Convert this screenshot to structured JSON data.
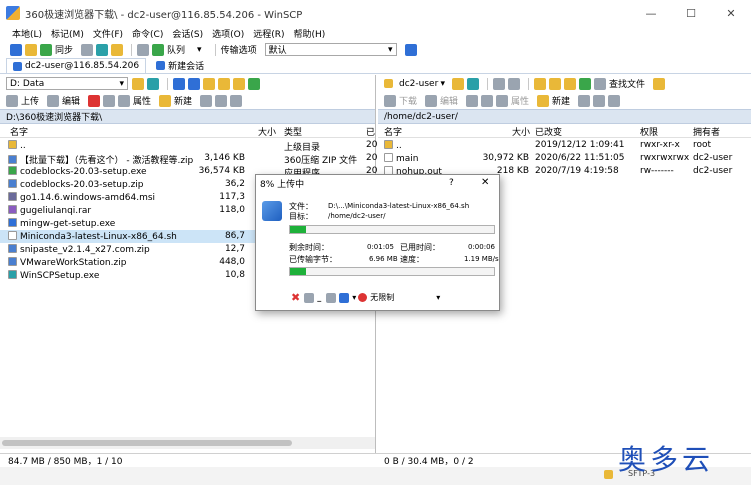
{
  "window": {
    "title": "360极速浏览器下载\\ - dc2-user@116.85.54.206 - WinSCP",
    "controls": [
      "—",
      "☐",
      "✕"
    ]
  },
  "menu": [
    "本地(L)",
    "标记(M)",
    "文件(F)",
    "命令(C)",
    "会话(S)",
    "选项(O)",
    "远程(R)",
    "帮助(H)"
  ],
  "toolbar": {
    "sync_label": "同步",
    "queue_label": "队列",
    "transfer_label": "传输选项",
    "transfer_value": "默认"
  },
  "tabs": {
    "session": "dc2-user@116.85.54.206",
    "new_session": "新建会话"
  },
  "left": {
    "drive": "D: Data",
    "upload_label": "上传",
    "edit_label": "编辑",
    "props_label": "属性",
    "new_label": "新建",
    "path": "D:\\360极速浏览器下载\\",
    "headers": {
      "name": "名字",
      "size": "大小",
      "type": "类型",
      "changed": "已"
    },
    "rows": [
      {
        "name": "..",
        "size": "",
        "type": "上级目录",
        "changed": "20",
        "icon_color": "#e9b838",
        "selected": false
      },
      {
        "name": "【批量下载】（先看这个） - 激活教程等.zip",
        "size": "3,146 KB",
        "type": "360压缩 ZIP 文件",
        "changed": "20",
        "icon_color": "#4a7fd0",
        "selected": false
      },
      {
        "name": "codeblocks-20.03-setup.exe",
        "size": "36,574 KB",
        "type": "应用程序",
        "changed": "20",
        "icon_color": "#3aa64a",
        "selected": false
      },
      {
        "name": "codeblocks-20.03-setup.zip",
        "size": "36,2",
        "type": "",
        "changed": "",
        "icon_color": "#4a7fd0",
        "selected": false
      },
      {
        "name": "go1.14.6.windows-amd64.msi",
        "size": "117,3",
        "type": "",
        "changed": "",
        "icon_color": "#6a6a9a",
        "selected": false
      },
      {
        "name": "gugeliulanqi.rar",
        "size": "118,0",
        "type": "",
        "changed": "",
        "icon_color": "#8a5cc0",
        "selected": false
      },
      {
        "name": "mingw-get-setup.exe",
        "size": "",
        "type": "",
        "changed": "",
        "icon_color": "#2f6fd6",
        "selected": false
      },
      {
        "name": "Miniconda3-latest-Linux-x86_64.sh",
        "size": "86,7",
        "type": "",
        "changed": "",
        "icon_color": "#ffffff",
        "selected": true
      },
      {
        "name": "snipaste_v2.1.4_x27.com.zip",
        "size": "12,7",
        "type": "",
        "changed": "",
        "icon_color": "#4a7fd0",
        "selected": false
      },
      {
        "name": "VMwareWorkStation.zip",
        "size": "448,0",
        "type": "",
        "changed": "",
        "icon_color": "#4a7fd0",
        "selected": false
      },
      {
        "name": "WinSCPSetup.exe",
        "size": "10,8",
        "type": "",
        "changed": "",
        "icon_color": "#2aa0a8",
        "selected": false
      }
    ],
    "status": "84.7 MB / 850 MB，1 / 10"
  },
  "right": {
    "dir": "dc2-user",
    "find_label": "查找文件",
    "download_label": "下载",
    "edit_label": "编辑",
    "props_label": "属性",
    "new_label": "新建",
    "path": "/home/dc2-user/",
    "headers": {
      "name": "名字",
      "size": "大小",
      "changed": "已改变",
      "perms": "权限",
      "owner": "拥有者"
    },
    "rows": [
      {
        "name": "..",
        "size": "",
        "changed": "2019/12/12 1:09:41",
        "perms": "rwxr-xr-x",
        "owner": "root",
        "icon_color": "#e9b838"
      },
      {
        "name": "main",
        "size": "30,972 KB",
        "changed": "2020/6/22 11:51:05",
        "perms": "rwxrwxrwx",
        "owner": "dc2-user",
        "icon_color": "#ffffff"
      },
      {
        "name": "nohup.out",
        "size": "218 KB",
        "changed": "2020/7/19 4:19:58",
        "perms": "rw-------",
        "owner": "dc2-user",
        "icon_color": "#ffffff"
      }
    ],
    "status": "0 B / 30.4 MB，0 / 2"
  },
  "dialog": {
    "title": "8% 上传中",
    "help": "?",
    "close": "✕",
    "file_label": "文件：",
    "file_value": "D:\\...\\Miniconda3-latest-Linux-x86_64.sh",
    "target_label": "目标：",
    "target_value": "/home/dc2-user/",
    "remaining_label": "剩余时间：",
    "remaining_value": "0:01:05",
    "elapsed_label": "已用时间：",
    "elapsed_value": "0:00:06",
    "transferred_label": "已传输字节：",
    "transferred_value": "6.96 MB",
    "speed_label": "速度：",
    "speed_value": "1.19 MB/s",
    "file_progress": 0.08,
    "total_progress": 0.08,
    "limit_label": "无限制"
  },
  "watermark": "奥多云",
  "protocol": "SFTP-3"
}
